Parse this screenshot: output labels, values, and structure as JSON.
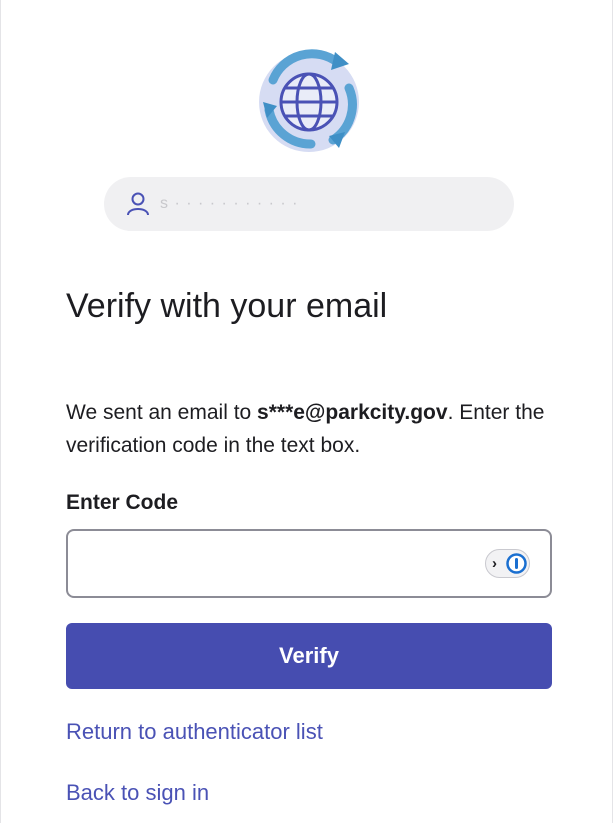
{
  "logo": {
    "icon": "globe-refresh-icon"
  },
  "identifier": {
    "icon": "user-icon",
    "masked_value": "s · · · · · · · · · · ·"
  },
  "header": {
    "title": "Verify with your email"
  },
  "description": {
    "prefix": "We sent an email to ",
    "email": "s***e@parkcity.gov",
    "suffix": ". Enter the verification code in the text box."
  },
  "form": {
    "code_label": "Enter Code",
    "code_value": "",
    "password_manager_icon": "password-manager-icon",
    "verify_label": "Verify"
  },
  "links": {
    "return_label": "Return to authenticator list",
    "back_label": "Back to sign in"
  },
  "colors": {
    "primary": "#464db0",
    "link": "#4a52b5",
    "logo_ring": "#6aa6d6",
    "logo_globe": "#4a52b5"
  }
}
